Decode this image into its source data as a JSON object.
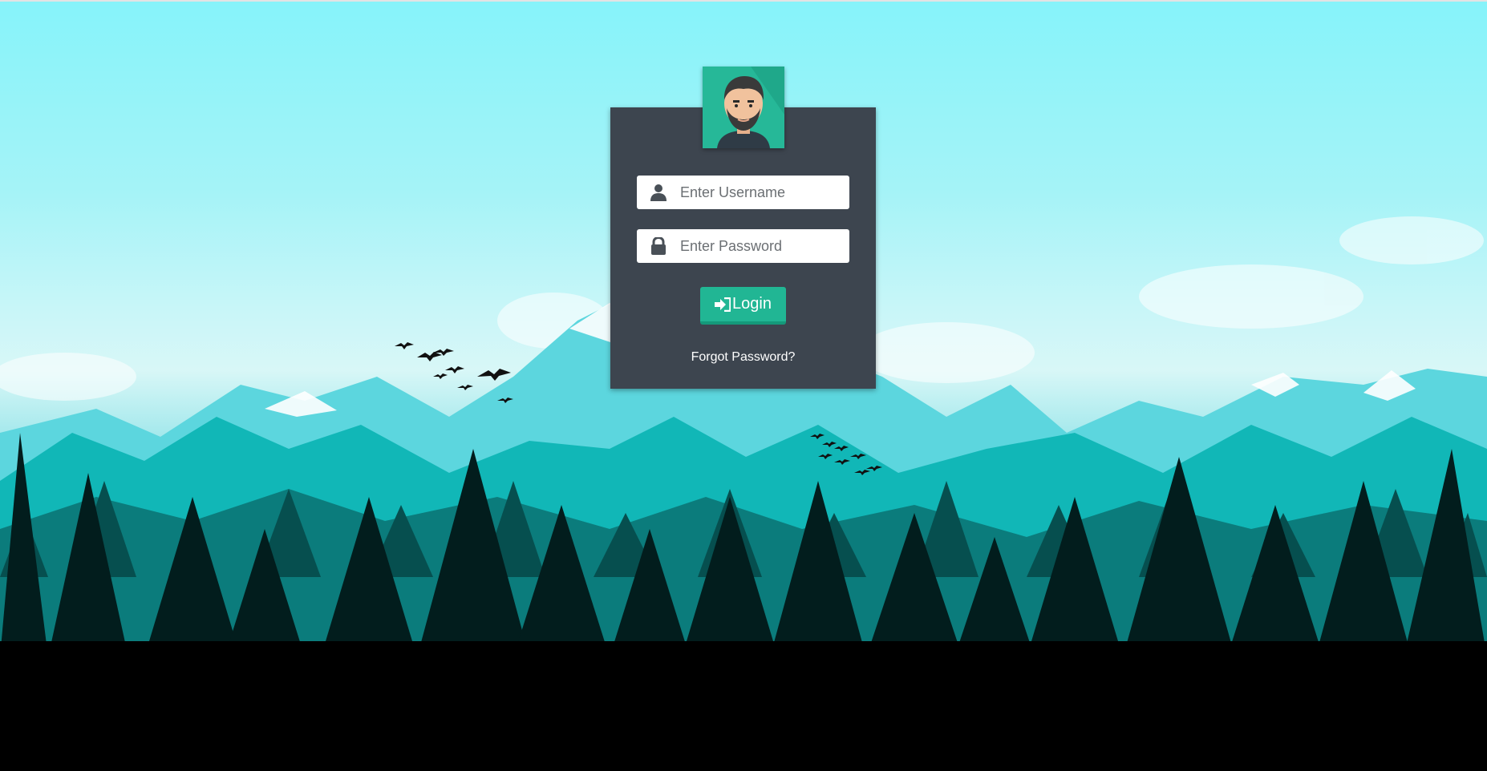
{
  "login": {
    "username_placeholder": "Enter Username",
    "password_placeholder": "Enter Password",
    "login_label": "Login",
    "forgot_label": "Forgot Password?"
  },
  "icons": {
    "username": "user-icon",
    "password": "lock-icon",
    "login": "sign-in-icon"
  },
  "colors": {
    "card": "#3d454f",
    "accent": "#21b694",
    "avatar_bg": "#26b898"
  }
}
